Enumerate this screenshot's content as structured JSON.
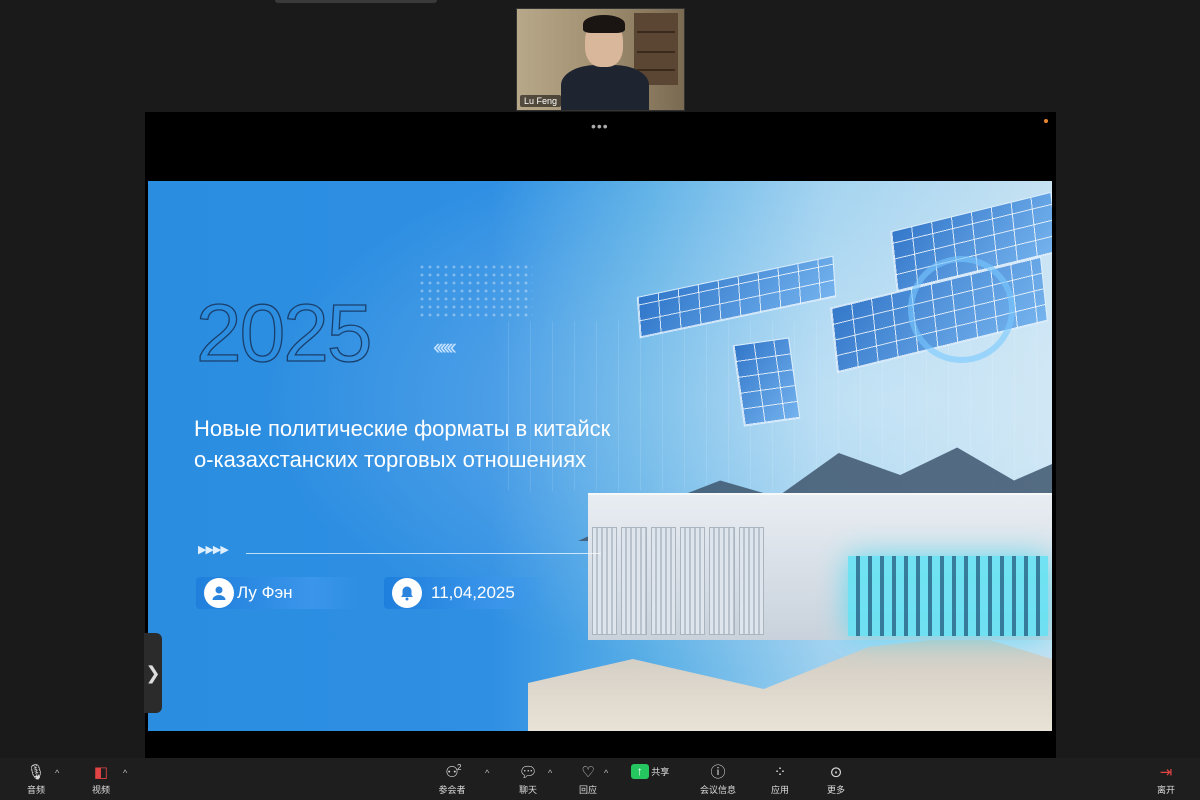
{
  "participant": {
    "name": "Lu Feng"
  },
  "slide": {
    "year": "2025",
    "chevrons": "‹‹‹‹‹‹",
    "title_line1": "Новые политические форматы в китайск",
    "title_line2": "о-казахстанских торговых отношениях",
    "divider_arrows": "▶▶▶▶",
    "author": "Лу Фэн",
    "date": "11,04,2025"
  },
  "share_handle": "•••",
  "side_toggle": "❯",
  "toolbar": {
    "audio": {
      "label": "音频",
      "icon": "microphone-icon"
    },
    "video": {
      "label": "视频",
      "icon": "video-off-icon"
    },
    "participants": {
      "label": "参会者",
      "count": "2",
      "icon": "participants-icon"
    },
    "chat": {
      "label": "聊天",
      "icon": "chat-icon"
    },
    "reactions": {
      "label": "回应",
      "icon": "heart-icon"
    },
    "share": {
      "label": "共享",
      "icon": "share-screen-icon"
    },
    "meeting_info": {
      "label": "会议信息",
      "icon": "info-icon"
    },
    "apps": {
      "label": "应用",
      "icon": "apps-icon"
    },
    "more": {
      "label": "更多",
      "icon": "more-icon"
    },
    "leave": {
      "label": "离开",
      "icon": "leave-icon"
    }
  },
  "colors": {
    "share_green": "#25c55f",
    "leave_red": "#e04444",
    "slide_blue": "#2a8de0"
  }
}
